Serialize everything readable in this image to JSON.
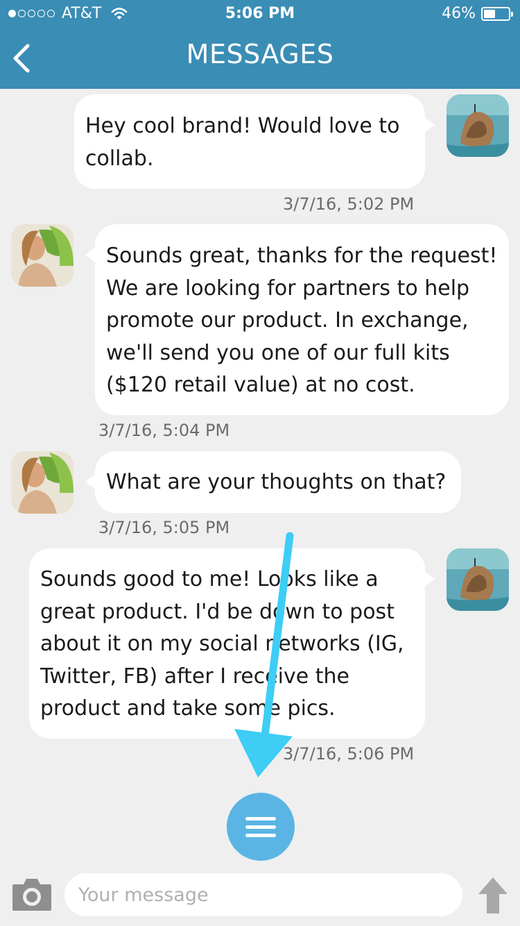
{
  "status_bar": {
    "carrier": "AT&T",
    "time": "5:06 PM",
    "battery": "46%",
    "battery_level": 0.46,
    "signal_bars_filled": 1,
    "signal_bars_total": 5
  },
  "header": {
    "title": "MESSAGES",
    "back_icon": "chevron-left-icon",
    "background_color": "#3a8db5"
  },
  "messages": [
    {
      "sender": "self",
      "text": "Hey cool brand! Would love to collab.",
      "timestamp": "3/7/16, 5:02 PM"
    },
    {
      "sender": "brand",
      "text": "Sounds great, thanks for the request! We are looking for partners to help promote our product. In exchange, we'll send you one of our full kits ($120 retail value) at no cost.",
      "timestamp": "3/7/16, 5:04 PM"
    },
    {
      "sender": "brand",
      "text": "What are your thoughts on that?",
      "timestamp": "3/7/16, 5:05 PM"
    },
    {
      "sender": "self",
      "text": "Sounds good to me! Looks like a great product. I'd be down to post about it on my social networks (IG, Twitter, FB) after I receive the product and take some pics.",
      "timestamp": "3/7/16, 5:06 PM"
    }
  ],
  "menu_button": {
    "icon": "hamburger-menu-icon",
    "color": "#5ab5e4"
  },
  "annotation_arrow_color": "#3dcdf5",
  "composer": {
    "placeholder": "Your message",
    "camera_icon": "camera-icon",
    "send_icon": "up-arrow-icon"
  }
}
